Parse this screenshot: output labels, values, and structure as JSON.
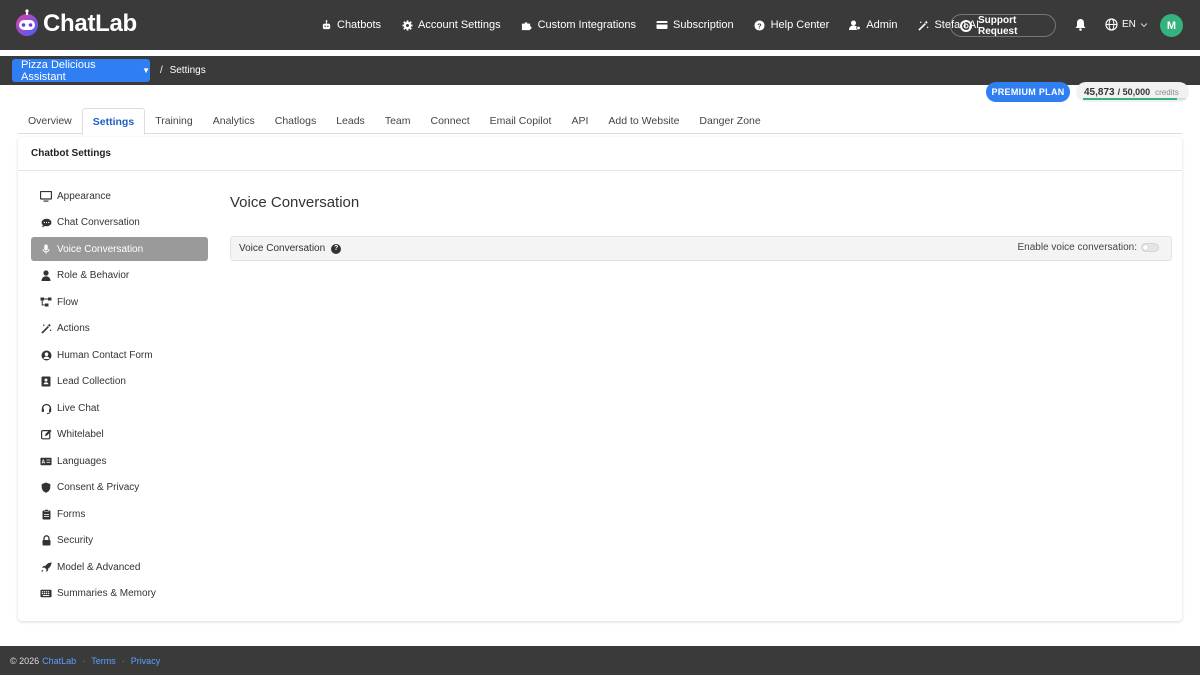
{
  "brand": {
    "name": "ChatLab"
  },
  "nav": {
    "items": [
      {
        "icon": "robot-icon",
        "label": "Chatbots"
      },
      {
        "icon": "gear-icon",
        "label": "Account Settings"
      },
      {
        "icon": "puzzle-icon",
        "label": "Custom Integrations"
      },
      {
        "icon": "credit-card-icon",
        "label": "Subscription"
      },
      {
        "icon": "help-circle-icon",
        "label": "Help Center"
      },
      {
        "icon": "user-cog-icon",
        "label": "Admin"
      },
      {
        "icon": "magic-wand-icon",
        "label": "Stefan AI"
      }
    ],
    "support_label": "Support Request",
    "language": "EN",
    "avatar_initial": "M"
  },
  "breadcrumb": {
    "bot_name": "Pizza Delicious Assistant",
    "separator": "/",
    "current": "Settings"
  },
  "plan": {
    "label": "PREMIUM PLAN",
    "credits_used": "45,873",
    "credits_total": "/ 50,000",
    "credits_unit": "credits",
    "credits_fraction": 0.917
  },
  "tabs": [
    {
      "label": "Overview",
      "active": false
    },
    {
      "label": "Settings",
      "active": true
    },
    {
      "label": "Training",
      "active": false
    },
    {
      "label": "Analytics",
      "active": false
    },
    {
      "label": "Chatlogs",
      "active": false
    },
    {
      "label": "Leads",
      "active": false
    },
    {
      "label": "Team",
      "active": false
    },
    {
      "label": "Connect",
      "active": false
    },
    {
      "label": "Email Copilot",
      "active": false
    },
    {
      "label": "API",
      "active": false
    },
    {
      "label": "Add to Website",
      "active": false
    },
    {
      "label": "Danger Zone",
      "active": false
    }
  ],
  "card": {
    "title": "Chatbot Settings"
  },
  "side_menu": [
    {
      "icon": "monitor-icon",
      "label": "Appearance",
      "active": false
    },
    {
      "icon": "chat-bubble-icon",
      "label": "Chat Conversation",
      "active": false
    },
    {
      "icon": "microphone-icon",
      "label": "Voice Conversation",
      "active": true
    },
    {
      "icon": "user-icon",
      "label": "Role & Behavior",
      "active": false
    },
    {
      "icon": "flow-icon",
      "label": "Flow",
      "active": false
    },
    {
      "icon": "magic-wand-icon",
      "label": "Actions",
      "active": false
    },
    {
      "icon": "user-circle-icon",
      "label": "Human Contact Form",
      "active": false
    },
    {
      "icon": "contact-card-icon",
      "label": "Lead Collection",
      "active": false
    },
    {
      "icon": "headset-icon",
      "label": "Live Chat",
      "active": false
    },
    {
      "icon": "edit-icon",
      "label": "Whitelabel",
      "active": false
    },
    {
      "icon": "language-icon",
      "label": "Languages",
      "active": false
    },
    {
      "icon": "shield-icon",
      "label": "Consent & Privacy",
      "active": false
    },
    {
      "icon": "clipboard-icon",
      "label": "Forms",
      "active": false
    },
    {
      "icon": "lock-icon",
      "label": "Security",
      "active": false
    },
    {
      "icon": "rocket-icon",
      "label": "Model & Advanced",
      "active": false
    },
    {
      "icon": "keyboard-icon",
      "label": "Summaries & Memory",
      "active": false
    }
  ],
  "main": {
    "title": "Voice Conversation",
    "row_label": "Voice Conversation",
    "help_glyph": "?",
    "toggle_label": "Enable voice conversation:",
    "toggle_on": false
  },
  "footer": {
    "copyright": "© 2026",
    "brand_link": "ChatLab",
    "separator": "·",
    "terms": "Terms",
    "privacy": "Privacy"
  },
  "colors": {
    "accent": "#2f7ff3",
    "navbar": "#3a3a3a",
    "avatar": "#35b37e",
    "active_menu": "#9a9a9a"
  }
}
